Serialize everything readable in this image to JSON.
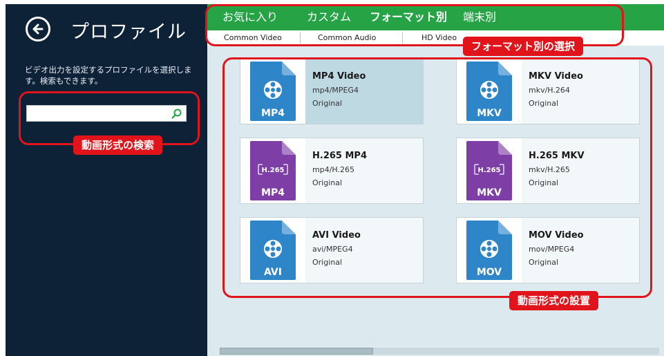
{
  "sidebar": {
    "title": "プロファイル",
    "description": "ビデオ出力を設定するプロファイルを選択します。検索もできます。",
    "search": {
      "value": "",
      "placeholder": ""
    }
  },
  "tabs": [
    {
      "label": "お気に入り",
      "active": false
    },
    {
      "label": "カスタム",
      "active": false
    },
    {
      "label": "フォーマット別",
      "active": true
    },
    {
      "label": "端末別",
      "active": false
    }
  ],
  "subtabs": [
    {
      "label": "Common Video"
    },
    {
      "label": "Common Audio"
    },
    {
      "label": "HD Video"
    }
  ],
  "formats": [
    {
      "name": "MP4 Video",
      "codec": "mp4/MPEG4",
      "quality": "Original",
      "badge": "MP4",
      "icon": "film-reel-icon",
      "color": "#2e86c9",
      "selected": true
    },
    {
      "name": "MKV Video",
      "codec": "mkv/H.264",
      "quality": "Original",
      "badge": "MKV",
      "icon": "film-reel-icon",
      "color": "#2e86c9",
      "selected": false
    },
    {
      "name": "H.265 MP4",
      "codec": "mp4/H.265",
      "quality": "Original",
      "badge": "MP4",
      "icon": "h265-icon",
      "icon_text": "H.265",
      "color": "#7d3fa6",
      "selected": false
    },
    {
      "name": "H.265 MKV",
      "codec": "mkv/H.265",
      "quality": "Original",
      "badge": "MKV",
      "icon": "h265-icon",
      "icon_text": "H.265",
      "color": "#7d3fa6",
      "selected": false
    },
    {
      "name": "AVI Video",
      "codec": "avi/MPEG4",
      "quality": "Original",
      "badge": "AVI",
      "icon": "film-reel-icon",
      "color": "#2e86c9",
      "selected": false
    },
    {
      "name": "MOV Video",
      "codec": "mov/MPEG4",
      "quality": "Original",
      "badge": "MOV",
      "icon": "film-reel-icon",
      "color": "#2e86c9",
      "selected": false
    }
  ],
  "annotations": {
    "search": "動画形式の検索",
    "tabs": "フォーマット別の選択",
    "formats": "動画形式の設置"
  },
  "colors": {
    "sidebar_bg": "#0d2137",
    "tab_bar": "#25a345",
    "content_bg": "#dce9ee",
    "annotation_red": "#e0141a",
    "video_icon_blue": "#2e86c9",
    "h265_icon_purple": "#7d3fa6"
  }
}
